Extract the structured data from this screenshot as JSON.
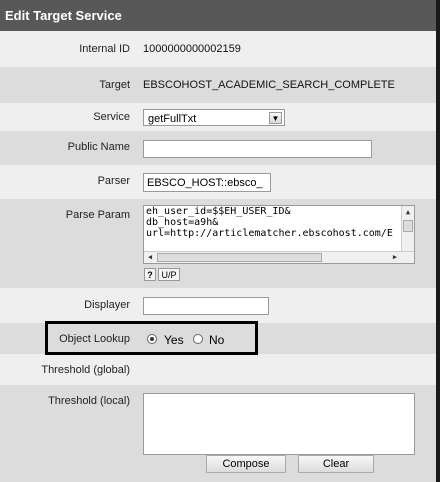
{
  "title": "Edit Target Service",
  "fields": {
    "internal_id": {
      "label": "Internal ID",
      "value": "1000000000002159"
    },
    "target": {
      "label": "Target",
      "value": "EBSCOHOST_ACADEMIC_SEARCH_COMPLETE"
    },
    "service": {
      "label": "Service",
      "value": "getFullTxt"
    },
    "public_name": {
      "label": "Public Name",
      "value": ""
    },
    "parser": {
      "label": "Parser",
      "value": "EBSCO_HOST::ebsco_"
    },
    "parse_param": {
      "label": "Parse Param",
      "lines": [
        "eh_user_id=$$EH_USER_ID&",
        "db_host=a9h&",
        "url=http://articlematcher.ebscohost.com/E"
      ],
      "help_label": "?",
      "up_label": "U/P"
    },
    "displayer": {
      "label": "Displayer",
      "value": ""
    },
    "object_lookup": {
      "label": "Object Lookup",
      "yes_label": "Yes",
      "no_label": "No",
      "selected": "Yes"
    },
    "threshold_global": {
      "label": "Threshold (global)"
    },
    "threshold_local": {
      "label": "Threshold (local)",
      "value": ""
    }
  },
  "buttons": {
    "compose": "Compose",
    "clear": "Clear"
  },
  "icons": {
    "select_arrow": "chevron-down-icon",
    "scroll_up": "arrow-up-icon",
    "scroll_down": "arrow-down-icon",
    "scroll_left": "arrow-left-icon",
    "scroll_right": "arrow-right-icon"
  }
}
